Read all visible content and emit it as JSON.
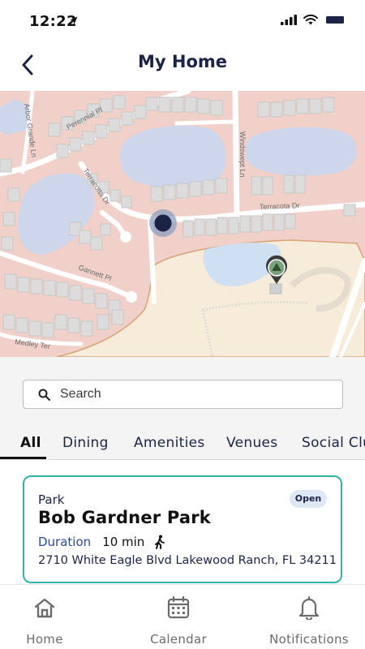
{
  "status_bar": {
    "time": "12:22"
  },
  "header": {
    "title": "My Home"
  },
  "map": {
    "street_labels": [
      "Perennial Pl",
      "Arbor Grande Ln",
      "Terracotta Dr",
      "Windswept Ln",
      "Terracota Dr",
      "Gannett Pl",
      "Medley Ter"
    ]
  },
  "search": {
    "placeholder": "Search"
  },
  "tabs": [
    {
      "label": "All",
      "active": true
    },
    {
      "label": "Dining",
      "active": false
    },
    {
      "label": "Amenities",
      "active": false
    },
    {
      "label": "Venues",
      "active": false
    },
    {
      "label": "Social Clu",
      "active": false
    }
  ],
  "place_card": {
    "category": "Park",
    "status_badge": "Open",
    "title": "Bob Gardner Park",
    "duration_label": "Duration",
    "duration_value": "10 min",
    "address": "2710 White Eagle Blvd Lakewood Ranch, FL 34211"
  },
  "bottom_nav": [
    {
      "label": "Home",
      "icon": "home-icon"
    },
    {
      "label": "Calendar",
      "icon": "calendar-icon"
    },
    {
      "label": "Notifications",
      "icon": "bell-icon"
    }
  ],
  "colors": {
    "accent": "#2fb3a6",
    "navy": "#1b2447",
    "badge_bg": "#dde7f6",
    "map_land": "#f0d0c8",
    "map_park": "#f7ecd9",
    "map_water": "#cdd6ea"
  }
}
